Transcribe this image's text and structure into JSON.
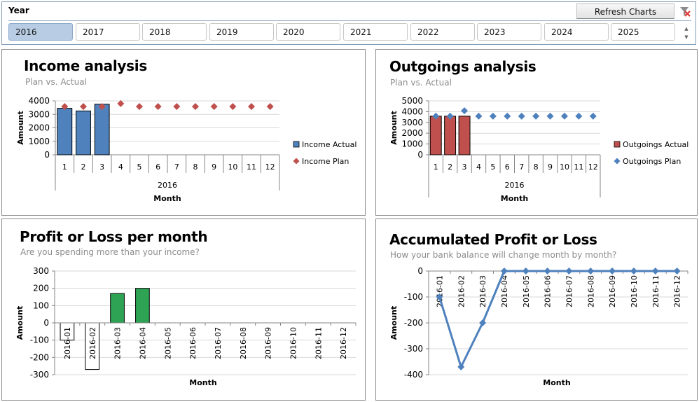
{
  "slicer": {
    "title": "Year",
    "refresh_label": "Refresh Charts",
    "clear_filter_icon": "filter-clear-icon",
    "selected": "2016",
    "years": [
      "2016",
      "2017",
      "2018",
      "2019",
      "2020",
      "2021",
      "2022",
      "2023",
      "2024",
      "2025"
    ],
    "spinner_up_icon": "▲",
    "spinner_down_icon": "▼"
  },
  "panels": {
    "income": {
      "title": "Income analysis",
      "subtitle": "Plan vs. Actual"
    },
    "outgoings": {
      "title": "Outgoings analysis",
      "subtitle": "Plan vs. Actual"
    },
    "profit": {
      "title": "Profit or Loss per month",
      "subtitle": "Are you spending more than your income?"
    },
    "accumulated": {
      "title": "Accumulated Profit or Loss",
      "subtitle": "How your bank balance will change month by month?"
    }
  },
  "colors": {
    "income_bar": "#4f81bd",
    "income_plan": "#c0504d",
    "outgoings_bar": "#c0504d",
    "outgoings_plan": "#4f81bd",
    "profit_positive": "#2ea354",
    "profit_negative": "#ffffff",
    "accumulated_line": "#4f81bd",
    "gridline": "#d9d9d9",
    "axis": "#868686"
  },
  "chart_data": [
    {
      "id": "income",
      "type": "bar",
      "title": "Income analysis",
      "subtitle": "Plan vs. Actual",
      "categories": [
        "1",
        "2",
        "3",
        "4",
        "5",
        "6",
        "7",
        "8",
        "9",
        "10",
        "11",
        "12"
      ],
      "group_label": "2016",
      "xlabel": "Month",
      "ylabel": "Amount",
      "ylim": [
        0,
        4000
      ],
      "yticks": [
        0,
        1000,
        2000,
        3000,
        4000
      ],
      "grid": true,
      "legend": "right",
      "series": [
        {
          "name": "Income Actual",
          "kind": "bar",
          "values": [
            3450,
            3250,
            3750,
            null,
            null,
            null,
            null,
            null,
            null,
            null,
            null,
            null
          ]
        },
        {
          "name": "Income Plan",
          "kind": "marker",
          "values": [
            3580,
            3580,
            3580,
            3800,
            3580,
            3580,
            3580,
            3580,
            3580,
            3580,
            3580,
            3580
          ]
        }
      ]
    },
    {
      "id": "outgoings",
      "type": "bar",
      "title": "Outgoings analysis",
      "subtitle": "Plan vs. Actual",
      "categories": [
        "1",
        "2",
        "3",
        "4",
        "5",
        "6",
        "7",
        "8",
        "9",
        "10",
        "11",
        "12"
      ],
      "group_label": "2016",
      "xlabel": "Month",
      "ylabel": "Amount",
      "ylim": [
        0,
        5000
      ],
      "yticks": [
        0,
        1000,
        2000,
        3000,
        4000,
        5000
      ],
      "grid": true,
      "legend": "right",
      "series": [
        {
          "name": "Outgoings Actual",
          "kind": "bar",
          "values": [
            3580,
            3580,
            3580,
            null,
            null,
            null,
            null,
            null,
            null,
            null,
            null,
            null
          ]
        },
        {
          "name": "Outgoings Plan",
          "kind": "marker",
          "values": [
            3580,
            3580,
            4080,
            3580,
            3580,
            3580,
            3580,
            3580,
            3580,
            3580,
            3580,
            3580
          ]
        }
      ]
    },
    {
      "id": "profit",
      "type": "bar",
      "title": "Profit or Loss per month",
      "subtitle": "Are you spending more than your income?",
      "categories": [
        "2016-01",
        "2016-02",
        "2016-03",
        "2016-04",
        "2016-05",
        "2016-06",
        "2016-07",
        "2016-08",
        "2016-09",
        "2016-10",
        "2016-11",
        "2016-12"
      ],
      "xlabel": "Month",
      "ylabel": "Amount",
      "ylim": [
        -300,
        300
      ],
      "yticks": [
        -300,
        -200,
        -100,
        0,
        100,
        200,
        300
      ],
      "grid": true,
      "values": [
        -100,
        -270,
        170,
        200,
        null,
        null,
        null,
        null,
        null,
        null,
        null,
        null
      ]
    },
    {
      "id": "accumulated",
      "type": "line",
      "title": "Accumulated Profit or Loss",
      "subtitle": "How your bank balance will change month by month?",
      "categories": [
        "2016-01",
        "2016-02",
        "2016-03",
        "2016-04",
        "2016-05",
        "2016-06",
        "2016-07",
        "2016-08",
        "2016-09",
        "2016-10",
        "2016-11",
        "2016-12"
      ],
      "xlabel": "Month",
      "ylabel": "Amount",
      "ylim": [
        -400,
        0
      ],
      "yticks": [
        -400,
        -300,
        -200,
        -100,
        0
      ],
      "grid": true,
      "values": [
        -100,
        -370,
        -200,
        0,
        0,
        0,
        0,
        0,
        0,
        0,
        0,
        0
      ]
    }
  ]
}
